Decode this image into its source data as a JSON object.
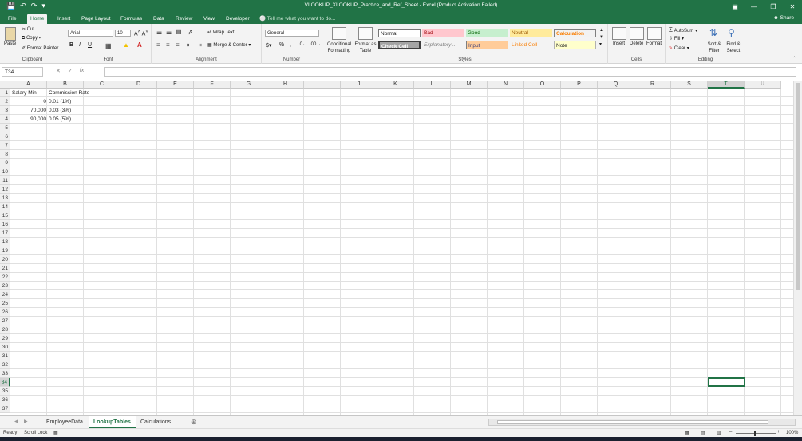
{
  "window": {
    "title": "VLOOKUP_XLOOKUP_Practice_and_Ref_Sheet - Excel (Product Activation Failed)"
  },
  "ribbon_tabs": [
    "File",
    "Home",
    "Insert",
    "Page Layout",
    "Formulas",
    "Data",
    "Review",
    "View",
    "Developer"
  ],
  "active_tab": "Home",
  "tell_me": "Tell me what you want to do...",
  "share": "Share",
  "clipboard": {
    "paste": "Paste",
    "cut": "Cut",
    "copy": "Copy",
    "format_painter": "Format Painter",
    "label": "Clipboard"
  },
  "font": {
    "name": "Arial",
    "size": "10",
    "label": "Font"
  },
  "alignment": {
    "wrap_text": "Wrap Text",
    "merge_center": "Merge & Center",
    "label": "Alignment"
  },
  "number": {
    "format": "General",
    "label": "Number"
  },
  "styles": {
    "conditional": "Conditional Formatting",
    "format_table": "Format as Table",
    "cells": [
      "Normal",
      "Bad",
      "Good",
      "Neutral",
      "Calculation",
      "Check Cell",
      "Explanatory ...",
      "Input",
      "Linked Cell",
      "Note"
    ],
    "label": "Styles"
  },
  "cells_group": {
    "insert": "Insert",
    "delete": "Delete",
    "format": "Format",
    "label": "Cells"
  },
  "editing": {
    "autosum": "AutoSum",
    "fill": "Fill",
    "clear": "Clear",
    "sort_filter": "Sort & Filter",
    "find_select": "Find & Select",
    "label": "Editing"
  },
  "name_box": "T34",
  "columns": [
    "A",
    "B",
    "C",
    "D",
    "E",
    "F",
    "G",
    "H",
    "I",
    "J",
    "K",
    "L",
    "M",
    "N",
    "O",
    "P",
    "Q",
    "R",
    "S",
    "T",
    "U"
  ],
  "sheet": {
    "headers": [
      "Salary Min",
      "Commission Rate"
    ],
    "rows": [
      [
        "0",
        "0.01 (1%)"
      ],
      [
        "70,000",
        "0.03 (3%)"
      ],
      [
        "90,000",
        "0.05 (5%)"
      ]
    ]
  },
  "sheet_tabs": [
    "EmployeeData",
    "LookupTables",
    "Calculations"
  ],
  "active_sheet": "LookupTables",
  "status": {
    "ready": "Ready",
    "scroll_lock": "Scroll Lock",
    "zoom": "100%"
  }
}
